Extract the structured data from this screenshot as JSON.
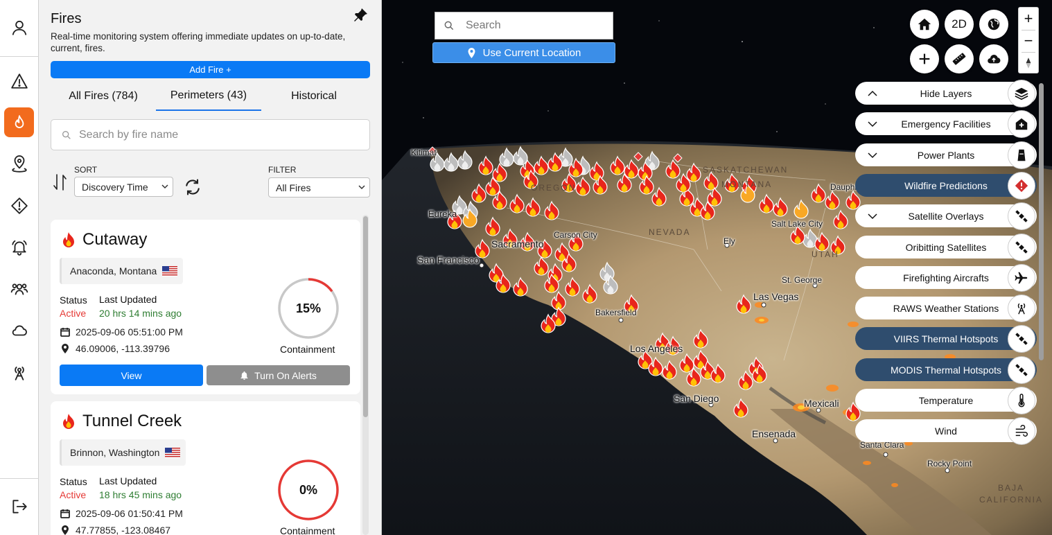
{
  "panel": {
    "title": "Fires",
    "description": "Real-time monitoring system offering immediate updates on up-to-date, current, fires.",
    "add_button": "Add Fire +",
    "tabs": [
      {
        "label": "All Fires (784)"
      },
      {
        "label": "Perimeters (43)",
        "active": true
      },
      {
        "label": "Historical"
      }
    ],
    "search_placeholder": "Search by fire name",
    "sort_label": "SORT",
    "sort_value": "Discovery Time",
    "filter_label": "FILTER",
    "filter_value": "All Fires"
  },
  "fires": [
    {
      "name": "Cutaway",
      "location": "Anaconda, Montana",
      "status_label": "Status",
      "status": "Active",
      "updated_label": "Last Updated",
      "updated": "20 hrs 14 mins ago",
      "date": "2025-09-06 05:51:00 PM",
      "coords": "46.09006, -113.39796",
      "containment_pct": 15,
      "containment_text": "15%",
      "containment_label": "Containment",
      "view_label": "View",
      "alert_label": "Turn On Alerts"
    },
    {
      "name": "Tunnel Creek",
      "location": "Brinnon, Washington",
      "status_label": "Status",
      "status": "Active",
      "updated_label": "Last Updated",
      "updated": "18 hrs 45 mins ago",
      "date": "2025-09-06 01:50:41 PM",
      "coords": "47.77855, -123.08467",
      "containment_pct": 0,
      "containment_text": "0%",
      "containment_label": "Containment"
    }
  ],
  "map": {
    "search_placeholder": "Search",
    "use_location": "Use Current Location",
    "mode_button": "2D",
    "zoom_in": "+",
    "zoom_out": "−",
    "cities": [
      "San Francisco",
      "Carson City",
      "Bakersfield",
      "Las Vegas",
      "St. George",
      "San Diego",
      "Mexicali",
      "Ensenada",
      "Ely",
      "Kitimat",
      "Eureka",
      "Dauphin",
      "Santa Clara",
      "Rocky Point",
      "Salt Lake City",
      "Los Angeles",
      "Sacramento"
    ],
    "regions": [
      "NEVADA",
      "BAJA CALIFORNIA",
      "MONTANA",
      "SASKATCHEWAN",
      "UTAH",
      "OREGON"
    ],
    "layers": [
      {
        "label": "Hide Layers",
        "icon": "layers-icon",
        "chevron": "up"
      },
      {
        "label": "Emergency Facilities",
        "icon": "hospital-icon",
        "chevron": "down"
      },
      {
        "label": "Power Plants",
        "icon": "power-plant-icon",
        "chevron": "down"
      },
      {
        "label": "Wildfire Predictions",
        "icon": "warning-diamond-icon",
        "active": true
      },
      {
        "label": "Satellite Overlays",
        "icon": "satellite-icon",
        "chevron": "down"
      },
      {
        "label": "Oribitting Satellites",
        "icon": "satellite-icon"
      },
      {
        "label": "Firefighting Aircrafts",
        "icon": "airplane-icon"
      },
      {
        "label": "RAWS Weather Stations",
        "icon": "antenna-icon"
      },
      {
        "label": "VIIRS Thermal Hotspots",
        "icon": "satellite-icon",
        "active": true
      },
      {
        "label": "MODIS Thermal Hotspots",
        "icon": "satellite-icon",
        "active": true
      },
      {
        "label": "Temperature",
        "icon": "thermometer-icon"
      },
      {
        "label": "Wind",
        "icon": "wind-icon"
      }
    ]
  },
  "colors": {
    "primary": "#0a7af5",
    "accent_orange": "#f26b1d",
    "active_red": "#e53935",
    "updated_green": "#2e7d32",
    "layer_active": "#2f4d6e"
  }
}
